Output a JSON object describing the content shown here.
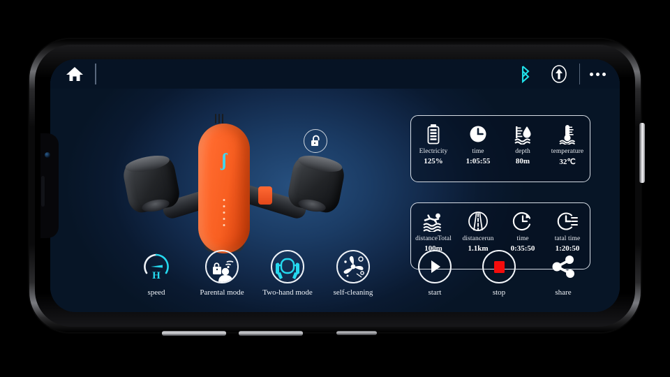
{
  "status_bar": {
    "home_icon": "home-icon",
    "bluetooth_icon": "bluetooth-icon",
    "bluetooth_color": "#20e0e8",
    "upload_icon": "arrow-up-circle-icon",
    "more_icon": "more-dots-icon"
  },
  "device": {
    "lock_icon": "unlock-padlock-icon",
    "brand_glyph": "ʃ",
    "body_color": "#ff6a2e",
    "accent_color": "#3fd8f2"
  },
  "telemetry": {
    "cells": [
      {
        "icon": "battery-icon",
        "label": "Electricity",
        "value": "125%"
      },
      {
        "icon": "clock-icon",
        "label": "time",
        "value": "1:05:55"
      },
      {
        "icon": "water-depth-icon",
        "label": "depth",
        "value": "80m"
      },
      {
        "icon": "thermometer-icon",
        "label": "temperature",
        "value": "32℃"
      }
    ]
  },
  "trip": {
    "cells": [
      {
        "icon": "swimmer-icon",
        "label": "distanceTotal",
        "value": "100m"
      },
      {
        "icon": "road-icon",
        "label": "distancerun",
        "value": "1.1km"
      },
      {
        "icon": "clock-reset-icon",
        "label": "time",
        "value": "0:35:50"
      },
      {
        "icon": "clock-lines-icon",
        "label": "tatal time",
        "value": "1:20:50"
      }
    ]
  },
  "modes": [
    {
      "icon": "speedometer-icon",
      "label": "speed"
    },
    {
      "icon": "parental-lock-icon",
      "label": "Parental mode"
    },
    {
      "icon": "two-hand-icon",
      "label": "Two-hand mode"
    },
    {
      "icon": "propeller-icon",
      "label": "self-cleaning"
    }
  ],
  "actions": [
    {
      "icon": "play-icon",
      "label": "start"
    },
    {
      "icon": "stop-icon",
      "label": "stop",
      "color": "#f40c0c"
    },
    {
      "icon": "share-icon",
      "label": "share"
    }
  ]
}
